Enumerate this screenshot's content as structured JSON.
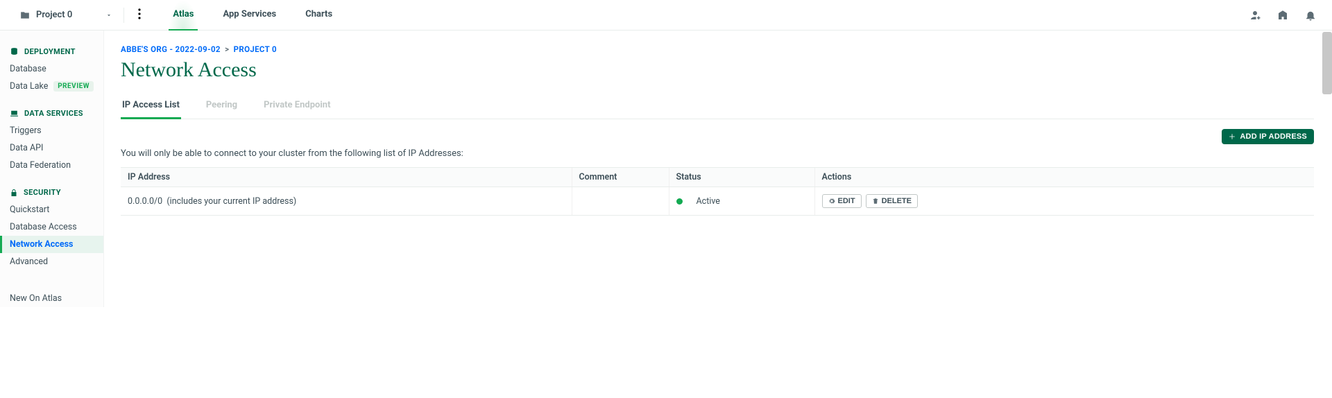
{
  "header": {
    "project_name": "Project 0",
    "tabs": [
      {
        "label": "Atlas",
        "active": true
      },
      {
        "label": "App Services",
        "active": false
      },
      {
        "label": "Charts",
        "active": false
      }
    ]
  },
  "sidebar": {
    "sections": [
      {
        "title": "DEPLOYMENT",
        "icon": "database-icon",
        "items": [
          {
            "label": "Database"
          },
          {
            "label": "Data Lake",
            "badge": "PREVIEW"
          }
        ]
      },
      {
        "title": "DATA SERVICES",
        "icon": "laptop-icon",
        "items": [
          {
            "label": "Triggers"
          },
          {
            "label": "Data API"
          },
          {
            "label": "Data Federation"
          }
        ]
      },
      {
        "title": "SECURITY",
        "icon": "lock-icon",
        "items": [
          {
            "label": "Quickstart"
          },
          {
            "label": "Database Access"
          },
          {
            "label": "Network Access",
            "active": true
          },
          {
            "label": "Advanced"
          }
        ]
      }
    ],
    "footer_item": "New On Atlas"
  },
  "breadcrumb": {
    "org": "ABBE'S ORG - 2022-09-02",
    "project": "PROJECT 0"
  },
  "page": {
    "title": "Network Access",
    "subtabs": [
      {
        "label": "IP Access List",
        "active": true
      },
      {
        "label": "Peering"
      },
      {
        "label": "Private Endpoint"
      }
    ],
    "add_button": "ADD IP ADDRESS",
    "description": "You will only be able to connect to your cluster from the following list of IP Addresses:",
    "table": {
      "columns": [
        "IP Address",
        "Comment",
        "Status",
        "Actions"
      ],
      "rows": [
        {
          "ip": "0.0.0.0/0",
          "ip_note": "(includes your current IP address)",
          "comment": "",
          "status": "Active",
          "edit_label": "EDIT",
          "delete_label": "DELETE"
        }
      ]
    }
  }
}
